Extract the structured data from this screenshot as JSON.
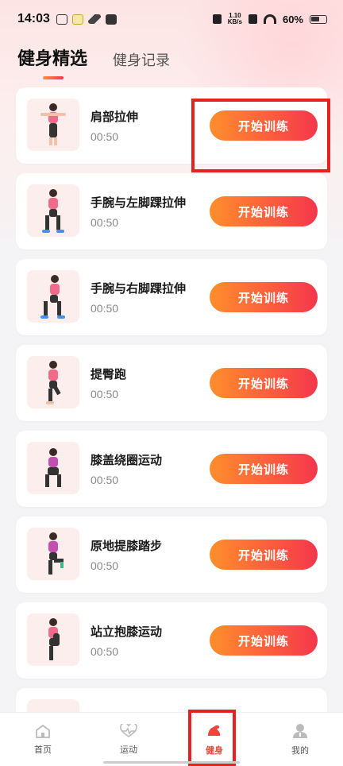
{
  "status_bar": {
    "time": "14:03",
    "speed_top": "1.10",
    "speed_unit": "KB/s",
    "battery_pct": "60%"
  },
  "tabs": [
    {
      "label": "健身精选",
      "active": true
    },
    {
      "label": "健身记录",
      "active": false
    }
  ],
  "exercises": [
    {
      "name": "肩部拉伸",
      "duration": "00:50",
      "button": "开始训练"
    },
    {
      "name": "手腕与左脚踝拉伸",
      "duration": "00:50",
      "button": "开始训练"
    },
    {
      "name": "手腕与右脚踝拉伸",
      "duration": "00:50",
      "button": "开始训练"
    },
    {
      "name": "提臀跑",
      "duration": "00:50",
      "button": "开始训练"
    },
    {
      "name": "膝盖绕圈运动",
      "duration": "00:50",
      "button": "开始训练"
    },
    {
      "name": "原地提膝踏步",
      "duration": "00:50",
      "button": "开始训练"
    },
    {
      "name": "站立抱膝运动",
      "duration": "00:50",
      "button": "开始训练"
    },
    {
      "name": "",
      "duration": "",
      "button": ""
    }
  ],
  "bottom_nav": [
    {
      "label": "首页",
      "icon": "home-icon",
      "active": false
    },
    {
      "label": "运动",
      "icon": "heartbeat-icon",
      "active": false
    },
    {
      "label": "健身",
      "icon": "muscle-arm-icon",
      "active": true
    },
    {
      "label": "我的",
      "icon": "user-icon",
      "active": false
    }
  ],
  "colors": {
    "accent_start": "#ff8e2c",
    "accent_end": "#f4364c",
    "active_nav": "#f0453b",
    "highlight": "#e52222"
  }
}
